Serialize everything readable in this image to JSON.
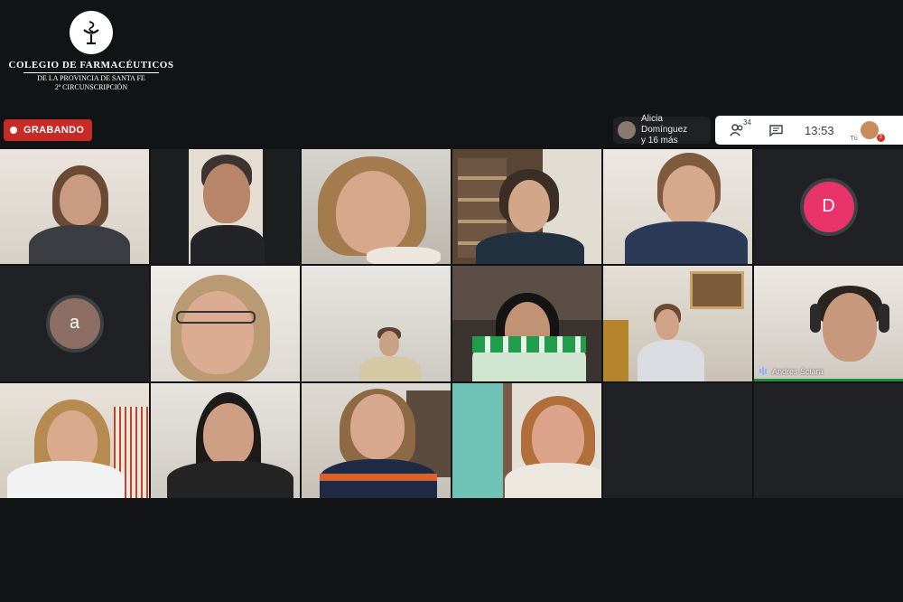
{
  "header": {
    "logo_title": "COLEGIO DE FARMACÉUTICOS",
    "logo_line1": "DE LA PROVINCIA DE SANTA FE",
    "logo_line2": "2ª CIRCUNSCRIPCIÓN",
    "logo_icon": "rod-of-asclepius-icon"
  },
  "recording": {
    "label": "GRABANDO",
    "color": "#c62b26"
  },
  "presenter": {
    "name_line1": "Alicia Domínguez",
    "name_line2": "y 16 más"
  },
  "topbar": {
    "people_icon": "people-icon",
    "participant_count": "34",
    "chat_icon": "chat-icon",
    "time": "13:53",
    "self_label": "Tú",
    "notification_count": "3"
  },
  "tiles": {
    "d_avatar": {
      "initial": "D",
      "color": "#e8336b"
    },
    "a_avatar": {
      "initial": "a",
      "color": "#8d6e63"
    },
    "speaker": {
      "name": "Andres Sciara"
    }
  }
}
